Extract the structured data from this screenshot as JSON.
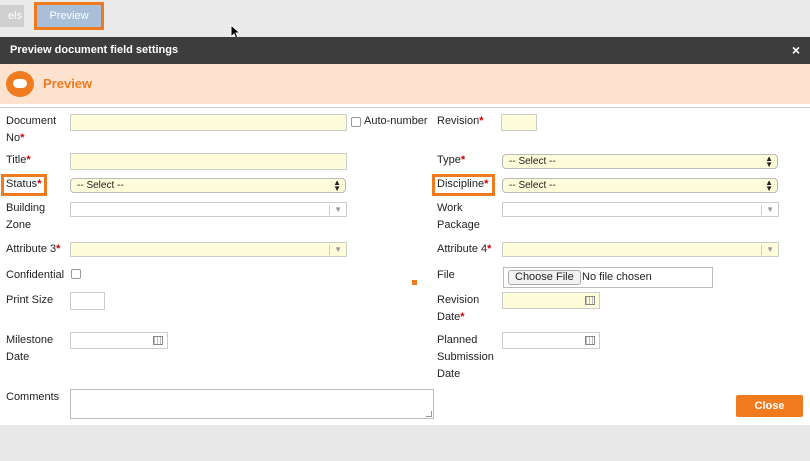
{
  "topbar": {
    "prev_tab_label": "els",
    "preview_button_label": "Preview"
  },
  "dialog": {
    "title": "Preview document field settings",
    "close_symbol": "×",
    "header_title": "Preview",
    "header_icon": "speech-bubble-icon"
  },
  "form": {
    "document_no": {
      "label_line1": "Document",
      "label_line2": "No",
      "required": "*"
    },
    "auto_number": {
      "label": "Auto-number"
    },
    "revision": {
      "label": "Revision",
      "required": "*"
    },
    "title": {
      "label": "Title",
      "required": "*"
    },
    "type": {
      "label": "Type",
      "required": "*",
      "value": "-- Select --"
    },
    "status": {
      "label": "Status",
      "required": "*",
      "value": "-- Select --"
    },
    "discipline": {
      "label": "Discipline",
      "required": "*",
      "value": "-- Select --"
    },
    "building_zone": {
      "label_line1": "Building",
      "label_line2": "Zone"
    },
    "work_package": {
      "label_line1": "Work",
      "label_line2": "Package"
    },
    "attribute3": {
      "label": "Attribute 3",
      "required": "*"
    },
    "attribute4": {
      "label": "Attribute 4",
      "required": "*"
    },
    "confidential": {
      "label": "Confidential"
    },
    "file": {
      "label": "File",
      "button": "Choose File",
      "status": "No file chosen"
    },
    "print_size": {
      "label": "Print Size"
    },
    "revision_date": {
      "label_line1": "Revision",
      "label_line2": "Date",
      "required": "*"
    },
    "milestone_date": {
      "label_line1": "Milestone",
      "label_line2": "Date"
    },
    "planned_submission_date": {
      "label_line1": "Planned",
      "label_line2": "Submission",
      "label_line3": "Date"
    },
    "comments": {
      "label": "Comments"
    }
  },
  "footer": {
    "close_label": "Close"
  },
  "colors": {
    "accent": "#f07b1f",
    "required_bg": "#fffcd9",
    "titlebar": "#3d3d3d"
  }
}
